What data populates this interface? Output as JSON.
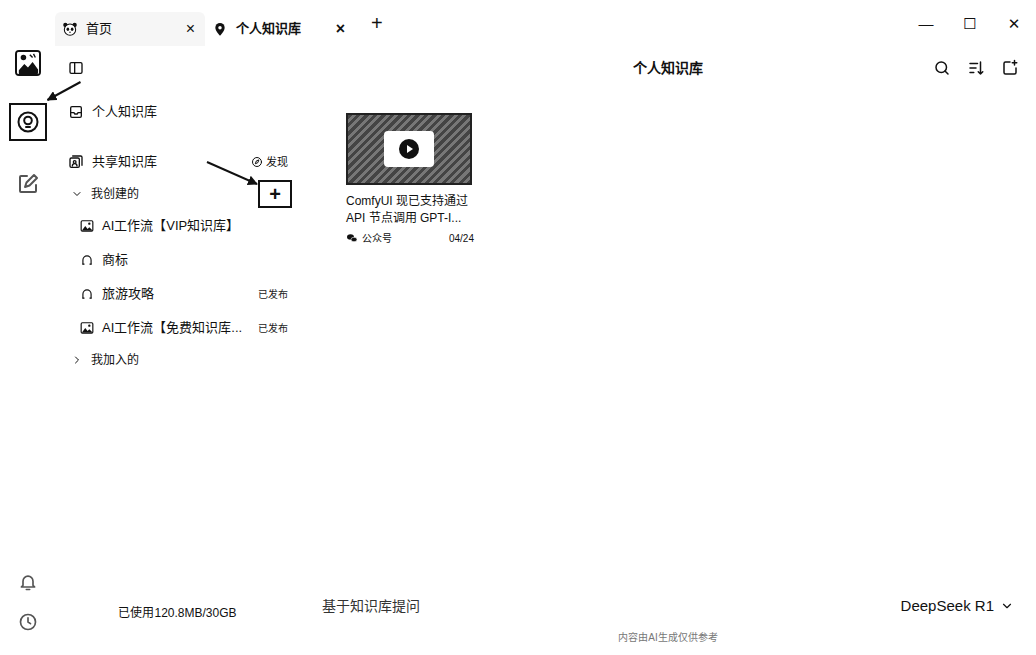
{
  "window": {
    "controls": [
      "—",
      "☐",
      "✕"
    ]
  },
  "tabs": [
    {
      "kind": "home",
      "label": "首页",
      "selected": false,
      "close": "×"
    },
    {
      "kind": "page",
      "label": "个人知识库",
      "selected": true,
      "close": "×"
    }
  ],
  "new_tab": "+",
  "rail": {
    "items": [
      {
        "kind": "knowledge",
        "selected": true,
        "highlighted": true
      },
      {
        "kind": "edit",
        "selected": false,
        "highlighted": false
      }
    ]
  },
  "sidebar": {
    "sections": [
      {
        "kind": "personal",
        "label": "个人知识库"
      },
      {
        "kind": "shared",
        "label": "共享知识库",
        "action": "发现"
      }
    ],
    "groups": [
      {
        "label": "我创建的",
        "expanded": true,
        "add_button": {
          "label": "+",
          "highlighted": true
        },
        "items": [
          {
            "kind": "collection",
            "label": "AI工作流【VIP知识库】"
          },
          {
            "kind": "folder",
            "label": "商标"
          },
          {
            "kind": "folder",
            "label": "旅游攻略",
            "status": "已发布"
          },
          {
            "kind": "collection",
            "label": "AI工作流【免费知识库...",
            "status": "已发布"
          }
        ]
      },
      {
        "label": "我加入的",
        "expanded": false
      }
    ],
    "storage": "已使用120.8MB/30GB"
  },
  "main": {
    "title": "个人知识库",
    "cards": [
      {
        "title": "ComfyUI 现已支持通过 API 节点调用 GPT-I...",
        "source": "公众号",
        "date": "04/24"
      }
    ]
  },
  "chat": {
    "placeholder": "基于知识库提问",
    "model": "DeepSeek R1",
    "disclaimer": "内容由AI生成仅供参考"
  }
}
